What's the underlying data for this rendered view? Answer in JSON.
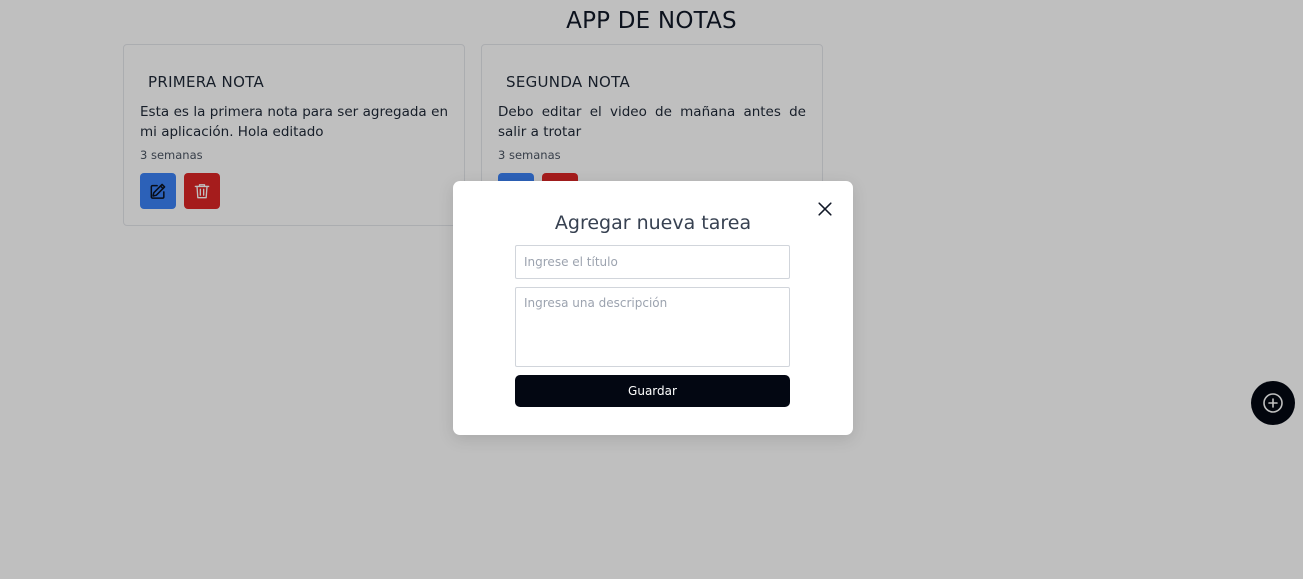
{
  "app": {
    "title": "APP DE NOTAS"
  },
  "notes": [
    {
      "title": "PRIMERA NOTA",
      "description": "Esta es la primera nota para ser agregada en mi aplicación. Hola editado",
      "time": "3 semanas",
      "edit_icon": "pencil-square-icon",
      "delete_icon": "trash-icon"
    },
    {
      "title": "SEGUNDA NOTA",
      "description": "Debo editar el video de mañana antes de salir a trotar",
      "time": "3 semanas",
      "edit_icon": "pencil-square-icon",
      "delete_icon": "trash-icon"
    }
  ],
  "fab": {
    "icon": "plus-circle-icon"
  },
  "modal": {
    "title": "Agregar nueva tarea",
    "close_icon": "close-icon",
    "title_input": {
      "placeholder": "Ingrese el título",
      "value": ""
    },
    "description_input": {
      "placeholder": "Ingresa una descripción",
      "value": ""
    },
    "save_label": "Guardar"
  },
  "colors": {
    "edit": "#3b82f6",
    "delete": "#dc2626",
    "primary_dark": "#030712",
    "overlay": "rgba(0,0,0,0.25)"
  }
}
